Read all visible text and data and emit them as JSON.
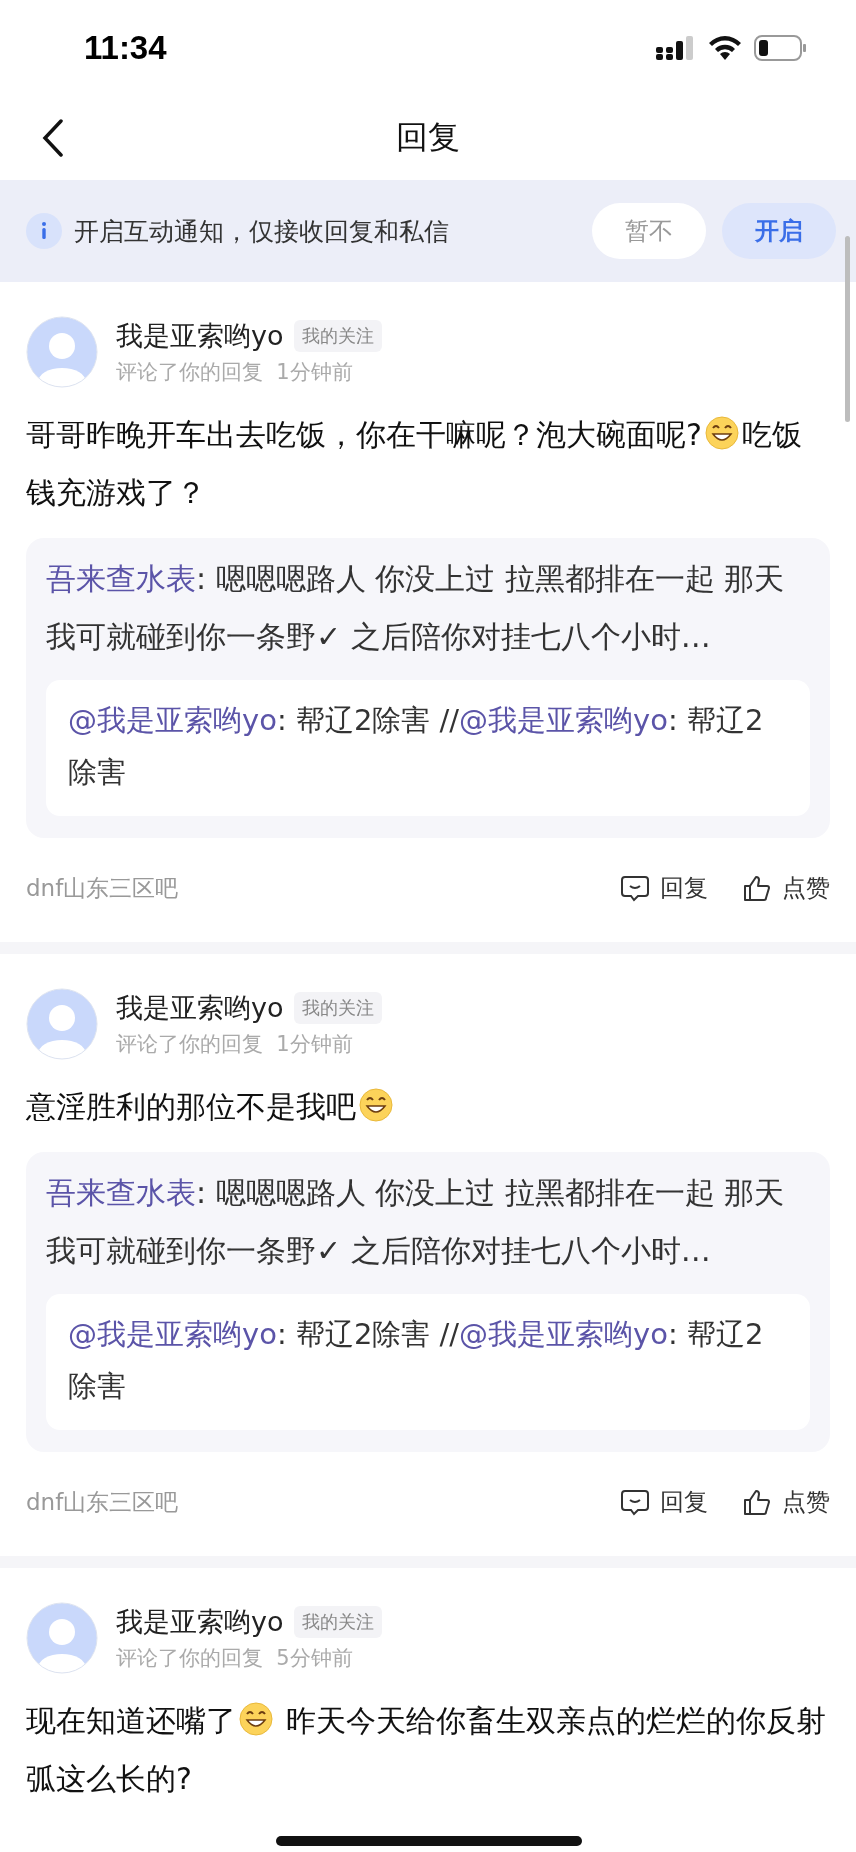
{
  "status_bar": {
    "time": "11:34"
  },
  "nav": {
    "title": "回复"
  },
  "banner": {
    "text": "开启互动通知，仅接收回复和私信",
    "buttons": [
      {
        "label": "暂不",
        "kind": "secondary"
      },
      {
        "label": "开启",
        "kind": "primary"
      }
    ]
  },
  "replies": [
    {
      "user": "我是亚索哟yo",
      "tag": "我的关注",
      "action": "评论了你的回复",
      "time": "1分钟前",
      "body": [
        {
          "kind": "text",
          "text": "哥哥昨晚开车出去吃饭，你在干嘛呢？泡大碗面呢?"
        },
        {
          "kind": "emoji"
        },
        {
          "kind": "text",
          "text": "吃饭钱充游戏了？"
        }
      ],
      "quote": {
        "author": "吾来查水表",
        "text": ": 嗯嗯嗯路人 你没上过 拉黑都排在一起 那天我可就碰到你一条野✓ 之后陪你对挂七八个小时…",
        "nested": [
          {
            "kind": "mention",
            "text": "@我是亚索哟yo"
          },
          {
            "kind": "text",
            "text": ": 帮辽2除害 //"
          },
          {
            "kind": "mention",
            "text": "@我是亚索哟yo"
          },
          {
            "kind": "text",
            "text": ": 帮辽2除害"
          }
        ]
      },
      "forum": "dnf山东三区吧",
      "actions": [
        {
          "label": "回复",
          "kind": "reply"
        },
        {
          "label": "点赞",
          "kind": "like"
        }
      ]
    },
    {
      "user": "我是亚索哟yo",
      "tag": "我的关注",
      "action": "评论了你的回复",
      "time": "1分钟前",
      "body": [
        {
          "kind": "text",
          "text": "意淫胜利的那位不是我吧"
        },
        {
          "kind": "emoji"
        }
      ],
      "quote": {
        "author": "吾来查水表",
        "text": ": 嗯嗯嗯路人 你没上过 拉黑都排在一起 那天我可就碰到你一条野✓ 之后陪你对挂七八个小时…",
        "nested": [
          {
            "kind": "mention",
            "text": "@我是亚索哟yo"
          },
          {
            "kind": "text",
            "text": ": 帮辽2除害 //"
          },
          {
            "kind": "mention",
            "text": "@我是亚索哟yo"
          },
          {
            "kind": "text",
            "text": ": 帮辽2除害"
          }
        ]
      },
      "forum": "dnf山东三区吧",
      "actions": [
        {
          "label": "回复",
          "kind": "reply"
        },
        {
          "label": "点赞",
          "kind": "like"
        }
      ]
    },
    {
      "user": "我是亚索哟yo",
      "tag": "我的关注",
      "action": "评论了你的回复",
      "time": "5分钟前",
      "body": [
        {
          "kind": "text",
          "text": "现在知道还嘴了"
        },
        {
          "kind": "emoji"
        },
        {
          "kind": "text",
          "text": " 昨天今天给你畜生双亲点的烂烂的你反射弧这么长的?"
        }
      ]
    }
  ]
}
